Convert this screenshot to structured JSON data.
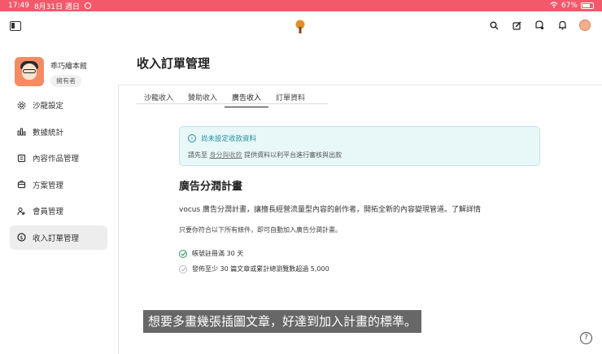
{
  "status_bar": {
    "time": "17:49",
    "date": "8月31日 週日",
    "battery": "67%"
  },
  "user": {
    "name": "乖巧繪本館",
    "role": "擁有者"
  },
  "sidebar": {
    "items": [
      {
        "label": "沙龍設定",
        "icon": "gear-icon"
      },
      {
        "label": "數據統計",
        "icon": "bar-chart-icon"
      },
      {
        "label": "內容作品管理",
        "icon": "document-icon"
      },
      {
        "label": "方案管理",
        "icon": "package-icon"
      },
      {
        "label": "會員管理",
        "icon": "members-icon"
      },
      {
        "label": "收入訂單管理",
        "icon": "dollar-icon"
      }
    ],
    "active_index": 5
  },
  "main": {
    "title": "收入訂單管理",
    "tabs": [
      {
        "label": "沙龍收入"
      },
      {
        "label": "贊助收入"
      },
      {
        "label": "廣告收入"
      },
      {
        "label": "訂單資料"
      }
    ],
    "active_tab": 2,
    "notice": {
      "title": "尚未設定收款資料",
      "text_before": "請先至",
      "link": "身分與收款",
      "text_after": "提供資料以利平台進行審核與出款"
    },
    "section_title": "廣告分潤計畫",
    "description": "vocus 廣告分潤計畫，讓擅長經營流量型內容的創作者，開拓全新的內容變現管道。了解詳情",
    "requirement_intro": "只要你符合以下所有條件，即可自動加入廣告分潤計畫。",
    "requirements": [
      {
        "label": "帳號註冊滿 30 天",
        "done": true
      },
      {
        "label": "發佈至少 30 篇文章或累計總瀏覽數超過 5,000",
        "done": false
      }
    ]
  },
  "subtitle": "想要多畫幾張插圖文章，好達到加入計畫的標準。",
  "help_label": "?",
  "colors": {
    "status_bar": "#f25a6b",
    "accent_teal": "#1f8f9c",
    "check_green": "#2e9a5c"
  }
}
